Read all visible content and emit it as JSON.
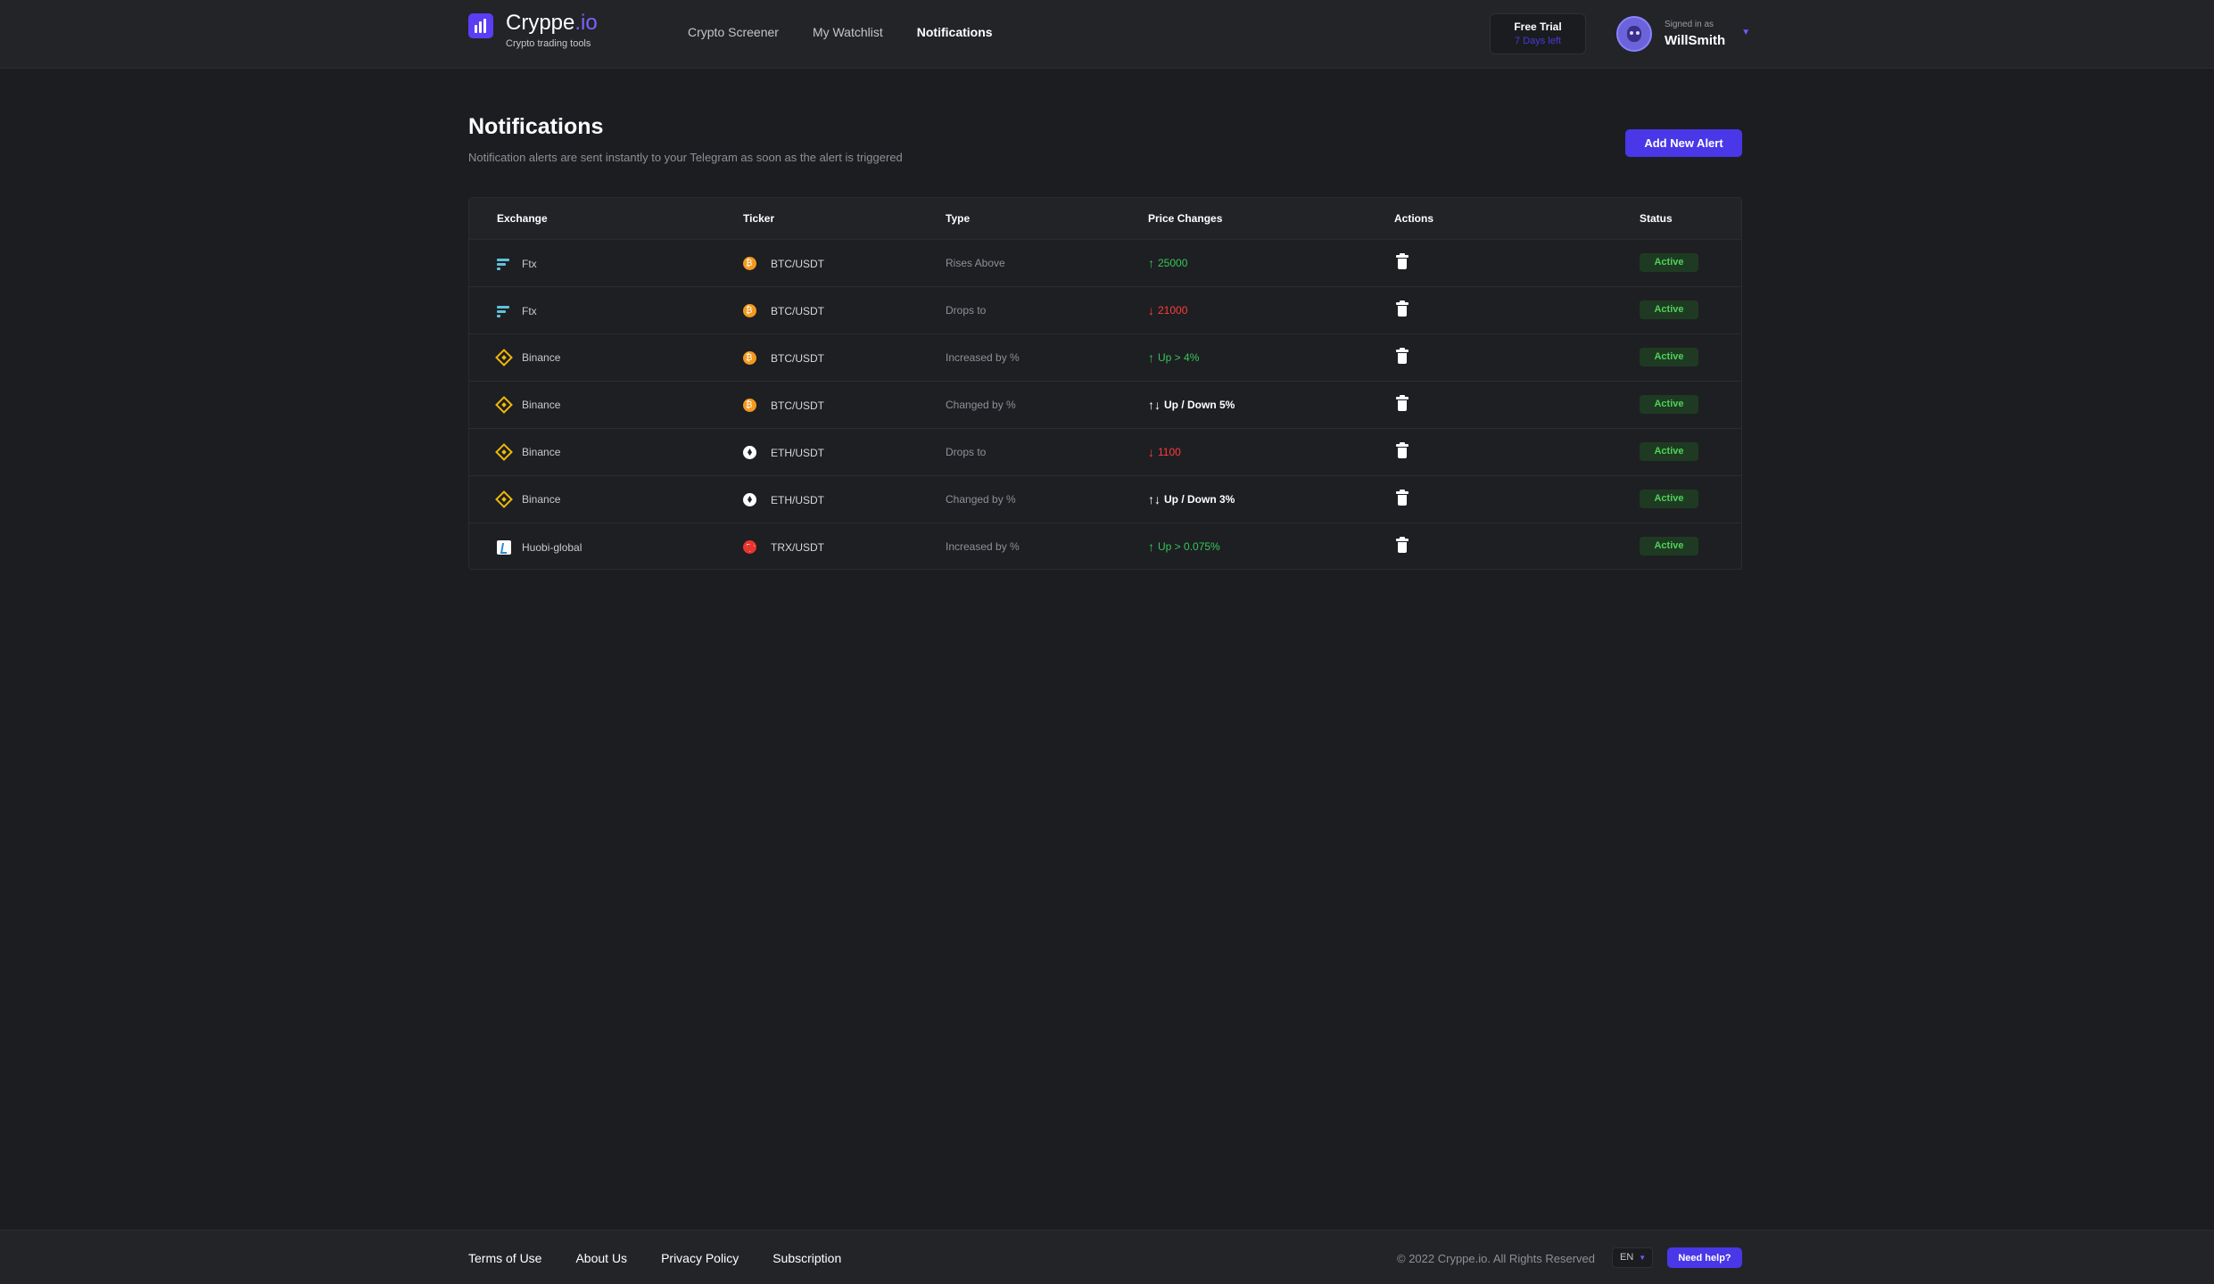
{
  "header": {
    "logo_name_main": "Cryppe",
    "logo_name_accent": ".io",
    "logo_tagline": "Crypto trading tools",
    "nav": [
      {
        "label": "Crypto Screener",
        "active": false
      },
      {
        "label": "My Watchlist",
        "active": false
      },
      {
        "label": "Notifications",
        "active": true
      }
    ],
    "trial": {
      "title": "Free Trial",
      "days_left": "7 Days left"
    },
    "user": {
      "signed_in_label": "Signed in as",
      "name": "WillSmith"
    }
  },
  "page": {
    "title": "Notifications",
    "subtitle": "Notification alerts are sent instantly to your Telegram as soon as the alert is triggered",
    "add_button_label": "Add New Alert"
  },
  "table": {
    "columns": [
      "Exchange",
      "Ticker",
      "Type",
      "Price Changes",
      "Actions",
      "Status"
    ],
    "rows": [
      {
        "exchange": "Ftx",
        "exchange_icon": "ftx-icon",
        "ticker": "BTC/USDT",
        "coin_icon": "btc-icon",
        "type": "Rises Above",
        "direction": "up",
        "change": "25000",
        "status": "Active"
      },
      {
        "exchange": "Ftx",
        "exchange_icon": "ftx-icon",
        "ticker": "BTC/USDT",
        "coin_icon": "btc-icon",
        "type": "Drops to",
        "direction": "down",
        "change": "21000",
        "status": "Active"
      },
      {
        "exchange": "Binance",
        "exchange_icon": "binance-icon",
        "ticker": "BTC/USDT",
        "coin_icon": "btc-icon",
        "type": "Increased by %",
        "direction": "up",
        "change": "Up > 4%",
        "status": "Active"
      },
      {
        "exchange": "Binance",
        "exchange_icon": "binance-icon",
        "ticker": "BTC/USDT",
        "coin_icon": "btc-icon",
        "type": "Changed by %",
        "direction": "both",
        "change": "Up / Down 5%",
        "status": "Active"
      },
      {
        "exchange": "Binance",
        "exchange_icon": "binance-icon",
        "ticker": "ETH/USDT",
        "coin_icon": "eth-icon",
        "type": "Drops to",
        "direction": "down",
        "change": "1100",
        "status": "Active"
      },
      {
        "exchange": "Binance",
        "exchange_icon": "binance-icon",
        "ticker": "ETH/USDT",
        "coin_icon": "eth-icon",
        "type": "Changed by %",
        "direction": "both",
        "change": "Up / Down 3%",
        "status": "Active"
      },
      {
        "exchange": "Huobi-global",
        "exchange_icon": "huobi-icon",
        "ticker": "TRX/USDT",
        "coin_icon": "trx-icon",
        "type": "Increased by %",
        "direction": "up",
        "change": "Up > 0.075%",
        "status": "Active"
      }
    ]
  },
  "footer": {
    "links": [
      "Terms of Use",
      "About Us",
      "Privacy Policy",
      "Subscription"
    ],
    "copyright": "© 2022 Cryppe.io. All Rights Reserved",
    "language": "EN",
    "help_label": "Need help?"
  },
  "colors": {
    "background": "#1c1d21",
    "accent": "#4a37e8",
    "up": "#34c759",
    "down": "#ff3b3b",
    "active_badge_bg": "#1f3a22",
    "active_badge_text": "#4ed15a"
  }
}
